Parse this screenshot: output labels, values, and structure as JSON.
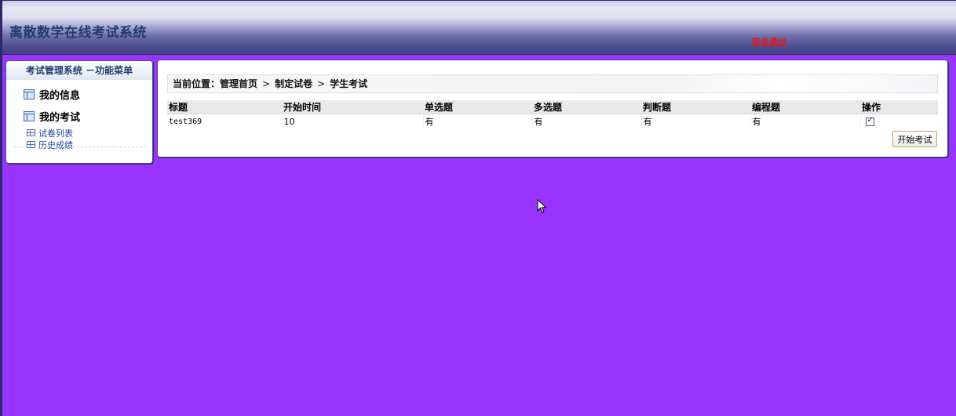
{
  "header": {
    "title": "离散数学在线考试系统",
    "logout_label": "安全退出"
  },
  "sidebar": {
    "title": "考试管理系统 －功能菜单",
    "groups": [
      {
        "label": "我的信息"
      },
      {
        "label": "我的考试"
      }
    ],
    "items": [
      {
        "label": "试卷列表"
      },
      {
        "label": "历史成绩"
      }
    ]
  },
  "main": {
    "breadcrumb": {
      "prefix": "当前位置：",
      "items": [
        "管理首页",
        "制定试卷",
        "学生考试"
      ],
      "separator": ">"
    },
    "table": {
      "columns": [
        "标题",
        "开始时间",
        "单选题",
        "多选题",
        "判断题",
        "编程题",
        "操作"
      ],
      "rows": [
        {
          "title": "test369",
          "start": "10",
          "single": "有",
          "multi": "有",
          "judge": "有",
          "program": "有",
          "selected": true
        }
      ]
    },
    "start_button_label": "开始考试"
  },
  "colors": {
    "background": "#9933ff",
    "logout": "#ee1111",
    "title": "#1f3d6e"
  }
}
